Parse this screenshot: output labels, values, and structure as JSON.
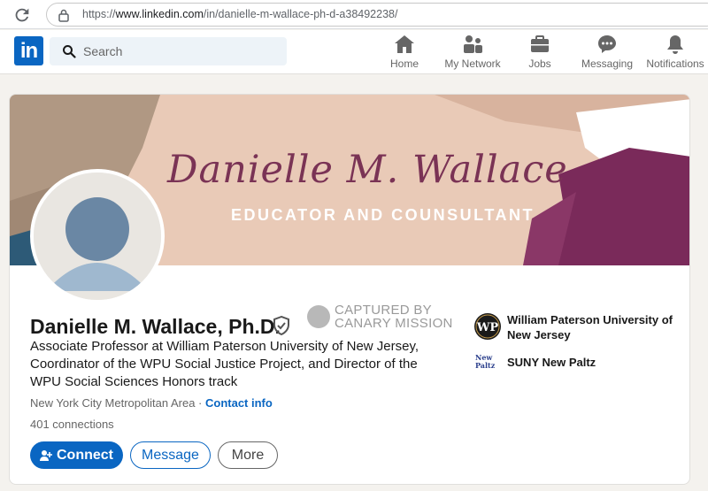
{
  "browser": {
    "url_prefix": "https://",
    "url_domain": "www.linkedin.com",
    "url_path": "/in/danielle-m-wallace-ph-d-a38492238/"
  },
  "nav": {
    "logo": "in",
    "search_placeholder": "Search",
    "items": [
      {
        "label": "Home",
        "icon": "home-icon"
      },
      {
        "label": "My Network",
        "icon": "network-icon"
      },
      {
        "label": "Jobs",
        "icon": "briefcase-icon"
      },
      {
        "label": "Messaging",
        "icon": "messaging-icon"
      },
      {
        "label": "Notifications",
        "icon": "bell-icon"
      }
    ]
  },
  "banner": {
    "name": "Danielle M. Wallace",
    "tagline": "EDUCATOR AND COUNSULTANT",
    "colors": {
      "base": "#e8c9b6",
      "plum": "#7a2a5a",
      "tan": "#b59a85",
      "navy": "#2e5b78"
    }
  },
  "watermark": {
    "line1": "CAPTURED BY",
    "line2": "CANARY MISSION"
  },
  "profile": {
    "name": "Danielle M. Wallace, Ph.D.",
    "headline": "Associate Professor at William Paterson University of New Jersey, Coordinator of the WPU Social Justice Project, and Director of the WPU Social Sciences Honors track",
    "location": "New York City Metropolitan Area",
    "separator": " · ",
    "contact_info": "Contact info",
    "connections": "401 connections"
  },
  "actions": {
    "connect": "Connect",
    "message": "Message",
    "more": "More"
  },
  "experience": [
    {
      "org": "William Paterson University of New Jersey",
      "logo": "wp-logo"
    },
    {
      "org": "SUNY New Paltz",
      "logo": "new-paltz-logo"
    }
  ],
  "accent_color": "#0a66c2"
}
